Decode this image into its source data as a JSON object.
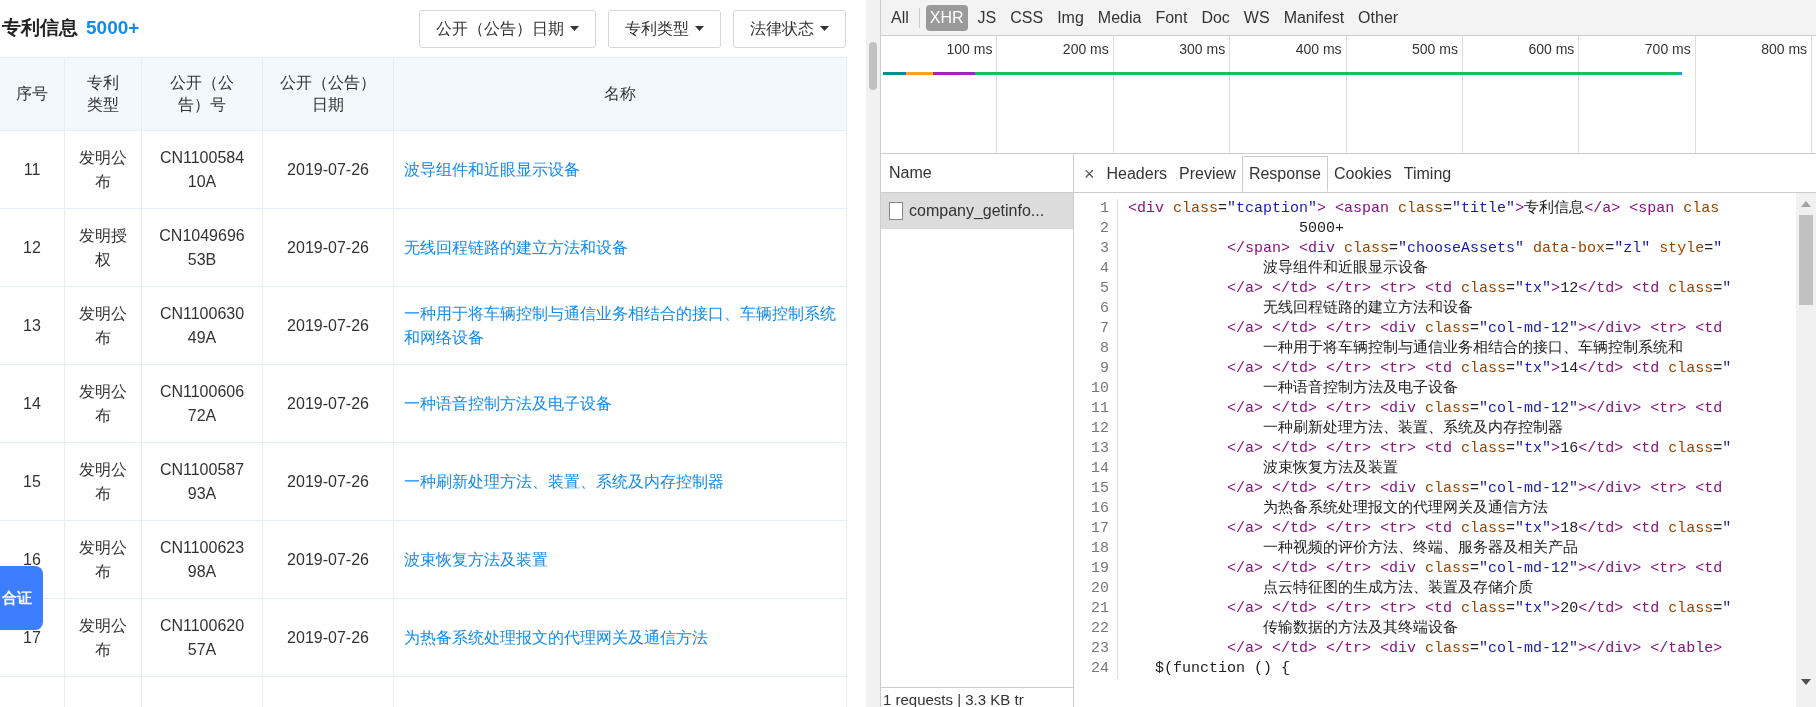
{
  "patents": {
    "title": "专利信息",
    "count": "5000+",
    "filters": [
      {
        "label": "公开（公告）日期"
      },
      {
        "label": "专利类型"
      },
      {
        "label": "法律状态"
      }
    ],
    "columns": [
      "序号",
      "专利类型",
      "公开（公告）号",
      "公开（公告）日期",
      "名称"
    ],
    "rows": [
      {
        "index": "11",
        "type": "发明公布",
        "number": "CN110058410A",
        "date": "2019-07-26",
        "name": "波导组件和近眼显示设备"
      },
      {
        "index": "12",
        "type": "发明授权",
        "number": "CN104969653B",
        "date": "2019-07-26",
        "name": "无线回程链路的建立方法和设备"
      },
      {
        "index": "13",
        "type": "发明公布",
        "number": "CN110063049A",
        "date": "2019-07-26",
        "name": "一种用于将车辆控制与通信业务相结合的接口、车辆控制系统和网络设备"
      },
      {
        "index": "14",
        "type": "发明公布",
        "number": "CN110060672A",
        "date": "2019-07-26",
        "name": "一种语音控制方法及电子设备"
      },
      {
        "index": "15",
        "type": "发明公布",
        "number": "CN110058793A",
        "date": "2019-07-26",
        "name": "一种刷新处理方法、装置、系统及内存控制器"
      },
      {
        "index": "16",
        "type": "发明公布",
        "number": "CN110062398A",
        "date": "2019-07-26",
        "name": "波束恢复方法及装置"
      },
      {
        "index": "17",
        "type": "发明公布",
        "number": "CN110062057A",
        "date": "2019-07-26",
        "name": "为热备系统处理报文的代理网关及通信方法"
      }
    ],
    "side_badge": "合证"
  },
  "devtools": {
    "type_filters": [
      {
        "label": "All",
        "selected": false
      },
      {
        "label": "XHR",
        "selected": true
      },
      {
        "label": "JS",
        "selected": false
      },
      {
        "label": "CSS",
        "selected": false
      },
      {
        "label": "Img",
        "selected": false
      },
      {
        "label": "Media",
        "selected": false
      },
      {
        "label": "Font",
        "selected": false
      },
      {
        "label": "Doc",
        "selected": false
      },
      {
        "label": "WS",
        "selected": false
      },
      {
        "label": "Manifest",
        "selected": false
      },
      {
        "label": "Other",
        "selected": false
      }
    ],
    "timeline_ticks": [
      "100 ms",
      "200 ms",
      "300 ms",
      "400 ms",
      "500 ms",
      "600 ms",
      "700 ms",
      "800 ms"
    ],
    "name_header": "Name",
    "requests": [
      {
        "name": "company_getinfo...",
        "selected": true
      }
    ],
    "footer": "1 requests | 3.3 KB tr",
    "close": "×",
    "tabs": [
      {
        "label": "Headers",
        "selected": false
      },
      {
        "label": "Preview",
        "selected": false
      },
      {
        "label": "Response",
        "selected": true
      },
      {
        "label": "Cookies",
        "selected": false
      },
      {
        "label": "Timing",
        "selected": false
      }
    ],
    "code_lines": [
      {
        "number": "1",
        "tokens": [
          {
            "kind": "tag",
            "text": "<div "
          },
          {
            "kind": "attr",
            "text": "class"
          },
          {
            "kind": "text",
            "text": "="
          },
          {
            "kind": "value",
            "text": "\"tcaption\""
          },
          {
            "kind": "tag",
            "text": "> <aspan "
          },
          {
            "kind": "attr",
            "text": "class"
          },
          {
            "kind": "text",
            "text": "="
          },
          {
            "kind": "value",
            "text": "\"title\""
          },
          {
            "kind": "tag",
            "text": ">"
          },
          {
            "kind": "text",
            "text": "专利信息"
          },
          {
            "kind": "tag",
            "text": "</a> <span "
          },
          {
            "kind": "attr",
            "text": "clas"
          }
        ]
      },
      {
        "number": "2",
        "tokens": [
          {
            "kind": "text",
            "text": "                   5000+"
          }
        ]
      },
      {
        "number": "3",
        "tokens": [
          {
            "kind": "tag",
            "text": "           </span> <div "
          },
          {
            "kind": "attr",
            "text": "class"
          },
          {
            "kind": "text",
            "text": "="
          },
          {
            "kind": "value",
            "text": "\"chooseAssets\""
          },
          {
            "kind": "attr",
            "text": " data-box"
          },
          {
            "kind": "text",
            "text": "="
          },
          {
            "kind": "value",
            "text": "\"zl\""
          },
          {
            "kind": "attr",
            "text": " style"
          },
          {
            "kind": "text",
            "text": "="
          },
          {
            "kind": "value",
            "text": "\""
          }
        ]
      },
      {
        "number": "4",
        "tokens": [
          {
            "kind": "text",
            "text": "               波导组件和近眼显示设备"
          }
        ]
      },
      {
        "number": "5",
        "tokens": [
          {
            "kind": "tag",
            "text": "           </a> </td> </tr> <tr> <td "
          },
          {
            "kind": "attr",
            "text": "class"
          },
          {
            "kind": "text",
            "text": "="
          },
          {
            "kind": "value",
            "text": "\"tx\""
          },
          {
            "kind": "tag",
            "text": ">"
          },
          {
            "kind": "text",
            "text": "12"
          },
          {
            "kind": "tag",
            "text": "</td> <td "
          },
          {
            "kind": "attr",
            "text": "class"
          },
          {
            "kind": "text",
            "text": "="
          },
          {
            "kind": "value",
            "text": "\""
          }
        ]
      },
      {
        "number": "6",
        "tokens": [
          {
            "kind": "text",
            "text": "               无线回程链路的建立方法和设备"
          }
        ]
      },
      {
        "number": "7",
        "tokens": [
          {
            "kind": "tag",
            "text": "           </a> </td> </tr> <div "
          },
          {
            "kind": "attr",
            "text": "class"
          },
          {
            "kind": "text",
            "text": "="
          },
          {
            "kind": "value",
            "text": "\"col-md-12\""
          },
          {
            "kind": "tag",
            "text": "></div> <tr> <td"
          }
        ]
      },
      {
        "number": "8",
        "tokens": [
          {
            "kind": "text",
            "text": "               一种用于将车辆控制与通信业务相结合的接口、车辆控制系统和"
          }
        ]
      },
      {
        "number": "9",
        "tokens": [
          {
            "kind": "tag",
            "text": "           </a> </td> </tr> <tr> <td "
          },
          {
            "kind": "attr",
            "text": "class"
          },
          {
            "kind": "text",
            "text": "="
          },
          {
            "kind": "value",
            "text": "\"tx\""
          },
          {
            "kind": "tag",
            "text": ">"
          },
          {
            "kind": "text",
            "text": "14"
          },
          {
            "kind": "tag",
            "text": "</td> <td "
          },
          {
            "kind": "attr",
            "text": "class"
          },
          {
            "kind": "text",
            "text": "="
          },
          {
            "kind": "value",
            "text": "\""
          }
        ]
      },
      {
        "number": "10",
        "tokens": [
          {
            "kind": "text",
            "text": "               一种语音控制方法及电子设备"
          }
        ]
      },
      {
        "number": "11",
        "tokens": [
          {
            "kind": "tag",
            "text": "           </a> </td> </tr> <div "
          },
          {
            "kind": "attr",
            "text": "class"
          },
          {
            "kind": "text",
            "text": "="
          },
          {
            "kind": "value",
            "text": "\"col-md-12\""
          },
          {
            "kind": "tag",
            "text": "></div> <tr> <td"
          }
        ]
      },
      {
        "number": "12",
        "tokens": [
          {
            "kind": "text",
            "text": "               一种刷新处理方法、装置、系统及内存控制器"
          }
        ]
      },
      {
        "number": "13",
        "tokens": [
          {
            "kind": "tag",
            "text": "           </a> </td> </tr> <tr> <td "
          },
          {
            "kind": "attr",
            "text": "class"
          },
          {
            "kind": "text",
            "text": "="
          },
          {
            "kind": "value",
            "text": "\"tx\""
          },
          {
            "kind": "tag",
            "text": ">"
          },
          {
            "kind": "text",
            "text": "16"
          },
          {
            "kind": "tag",
            "text": "</td> <td "
          },
          {
            "kind": "attr",
            "text": "class"
          },
          {
            "kind": "text",
            "text": "="
          },
          {
            "kind": "value",
            "text": "\""
          }
        ]
      },
      {
        "number": "14",
        "tokens": [
          {
            "kind": "text",
            "text": "               波束恢复方法及装置"
          }
        ]
      },
      {
        "number": "15",
        "tokens": [
          {
            "kind": "tag",
            "text": "           </a> </td> </tr> <div "
          },
          {
            "kind": "attr",
            "text": "class"
          },
          {
            "kind": "text",
            "text": "="
          },
          {
            "kind": "value",
            "text": "\"col-md-12\""
          },
          {
            "kind": "tag",
            "text": "></div> <tr> <td"
          }
        ]
      },
      {
        "number": "16",
        "tokens": [
          {
            "kind": "text",
            "text": "               为热备系统处理报文的代理网关及通信方法"
          }
        ]
      },
      {
        "number": "17",
        "tokens": [
          {
            "kind": "tag",
            "text": "           </a> </td> </tr> <tr> <td "
          },
          {
            "kind": "attr",
            "text": "class"
          },
          {
            "kind": "text",
            "text": "="
          },
          {
            "kind": "value",
            "text": "\"tx\""
          },
          {
            "kind": "tag",
            "text": ">"
          },
          {
            "kind": "text",
            "text": "18"
          },
          {
            "kind": "tag",
            "text": "</td> <td "
          },
          {
            "kind": "attr",
            "text": "class"
          },
          {
            "kind": "text",
            "text": "="
          },
          {
            "kind": "value",
            "text": "\""
          }
        ]
      },
      {
        "number": "18",
        "tokens": [
          {
            "kind": "text",
            "text": "               一种视频的评价方法、终端、服务器及相关产品"
          }
        ]
      },
      {
        "number": "19",
        "tokens": [
          {
            "kind": "tag",
            "text": "           </a> </td> </tr> <div "
          },
          {
            "kind": "attr",
            "text": "class"
          },
          {
            "kind": "text",
            "text": "="
          },
          {
            "kind": "value",
            "text": "\"col-md-12\""
          },
          {
            "kind": "tag",
            "text": "></div> <tr> <td"
          }
        ]
      },
      {
        "number": "20",
        "tokens": [
          {
            "kind": "text",
            "text": "               点云特征图的生成方法、装置及存储介质"
          }
        ]
      },
      {
        "number": "21",
        "tokens": [
          {
            "kind": "tag",
            "text": "           </a> </td> </tr> <tr> <td "
          },
          {
            "kind": "attr",
            "text": "class"
          },
          {
            "kind": "text",
            "text": "="
          },
          {
            "kind": "value",
            "text": "\"tx\""
          },
          {
            "kind": "tag",
            "text": ">"
          },
          {
            "kind": "text",
            "text": "20"
          },
          {
            "kind": "tag",
            "text": "</td> <td "
          },
          {
            "kind": "attr",
            "text": "class"
          },
          {
            "kind": "text",
            "text": "="
          },
          {
            "kind": "value",
            "text": "\""
          }
        ]
      },
      {
        "number": "22",
        "tokens": [
          {
            "kind": "text",
            "text": "               传输数据的方法及其终端设备"
          }
        ]
      },
      {
        "number": "23",
        "tokens": [
          {
            "kind": "tag",
            "text": "           </a> </td> </tr> <div "
          },
          {
            "kind": "attr",
            "text": "class"
          },
          {
            "kind": "text",
            "text": "="
          },
          {
            "kind": "value",
            "text": "\"col-md-12\""
          },
          {
            "kind": "tag",
            "text": "></div> </table>"
          }
        ]
      },
      {
        "number": "24",
        "tokens": [
          {
            "kind": "text",
            "text": "   $(function () {"
          }
        ]
      }
    ]
  }
}
